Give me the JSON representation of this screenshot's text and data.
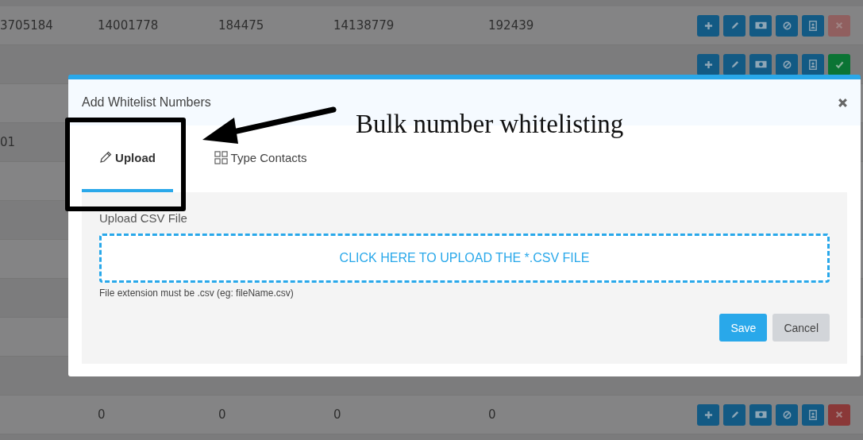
{
  "table": {
    "rows": [
      {
        "cells": [
          "3705184",
          "14001778",
          "184475",
          "14138779",
          "192439"
        ],
        "actions": [
          {
            "kind": "add"
          },
          {
            "kind": "edit"
          },
          {
            "kind": "money"
          },
          {
            "kind": "block"
          },
          {
            "kind": "contact"
          },
          {
            "kind": "delete",
            "disabled": true
          }
        ]
      },
      {
        "actions": [
          {
            "kind": "add"
          },
          {
            "kind": "edit"
          },
          {
            "kind": "money"
          },
          {
            "kind": "block"
          },
          {
            "kind": "contact"
          },
          {
            "kind": "approve",
            "disabled": false
          }
        ]
      },
      {
        "cells": [
          "01"
        ]
      },
      {
        "cells": [
          "",
          "0",
          "0",
          "0",
          "0"
        ],
        "actions": [
          {
            "kind": "add"
          },
          {
            "kind": "edit"
          },
          {
            "kind": "money"
          },
          {
            "kind": "block"
          },
          {
            "kind": "contact"
          },
          {
            "kind": "delete",
            "disabled": false
          }
        ]
      }
    ]
  },
  "modal": {
    "title": "Add Whitelist Numbers",
    "tabs": [
      {
        "label": "Upload",
        "selected": true
      },
      {
        "label": "Type Contacts",
        "selected": false
      }
    ],
    "field_label": "Upload CSV File",
    "dropzone": "CLICK HERE TO UPLOAD THE *.CSV FILE",
    "hint": "File extension must be .csv (eg: fileName.csv)",
    "buttons": [
      {
        "label": "Save",
        "kind": "primary"
      },
      {
        "label": "Cancel",
        "kind": "secondary"
      }
    ]
  },
  "annotation": {
    "text": "Bulk number whitelisting"
  }
}
